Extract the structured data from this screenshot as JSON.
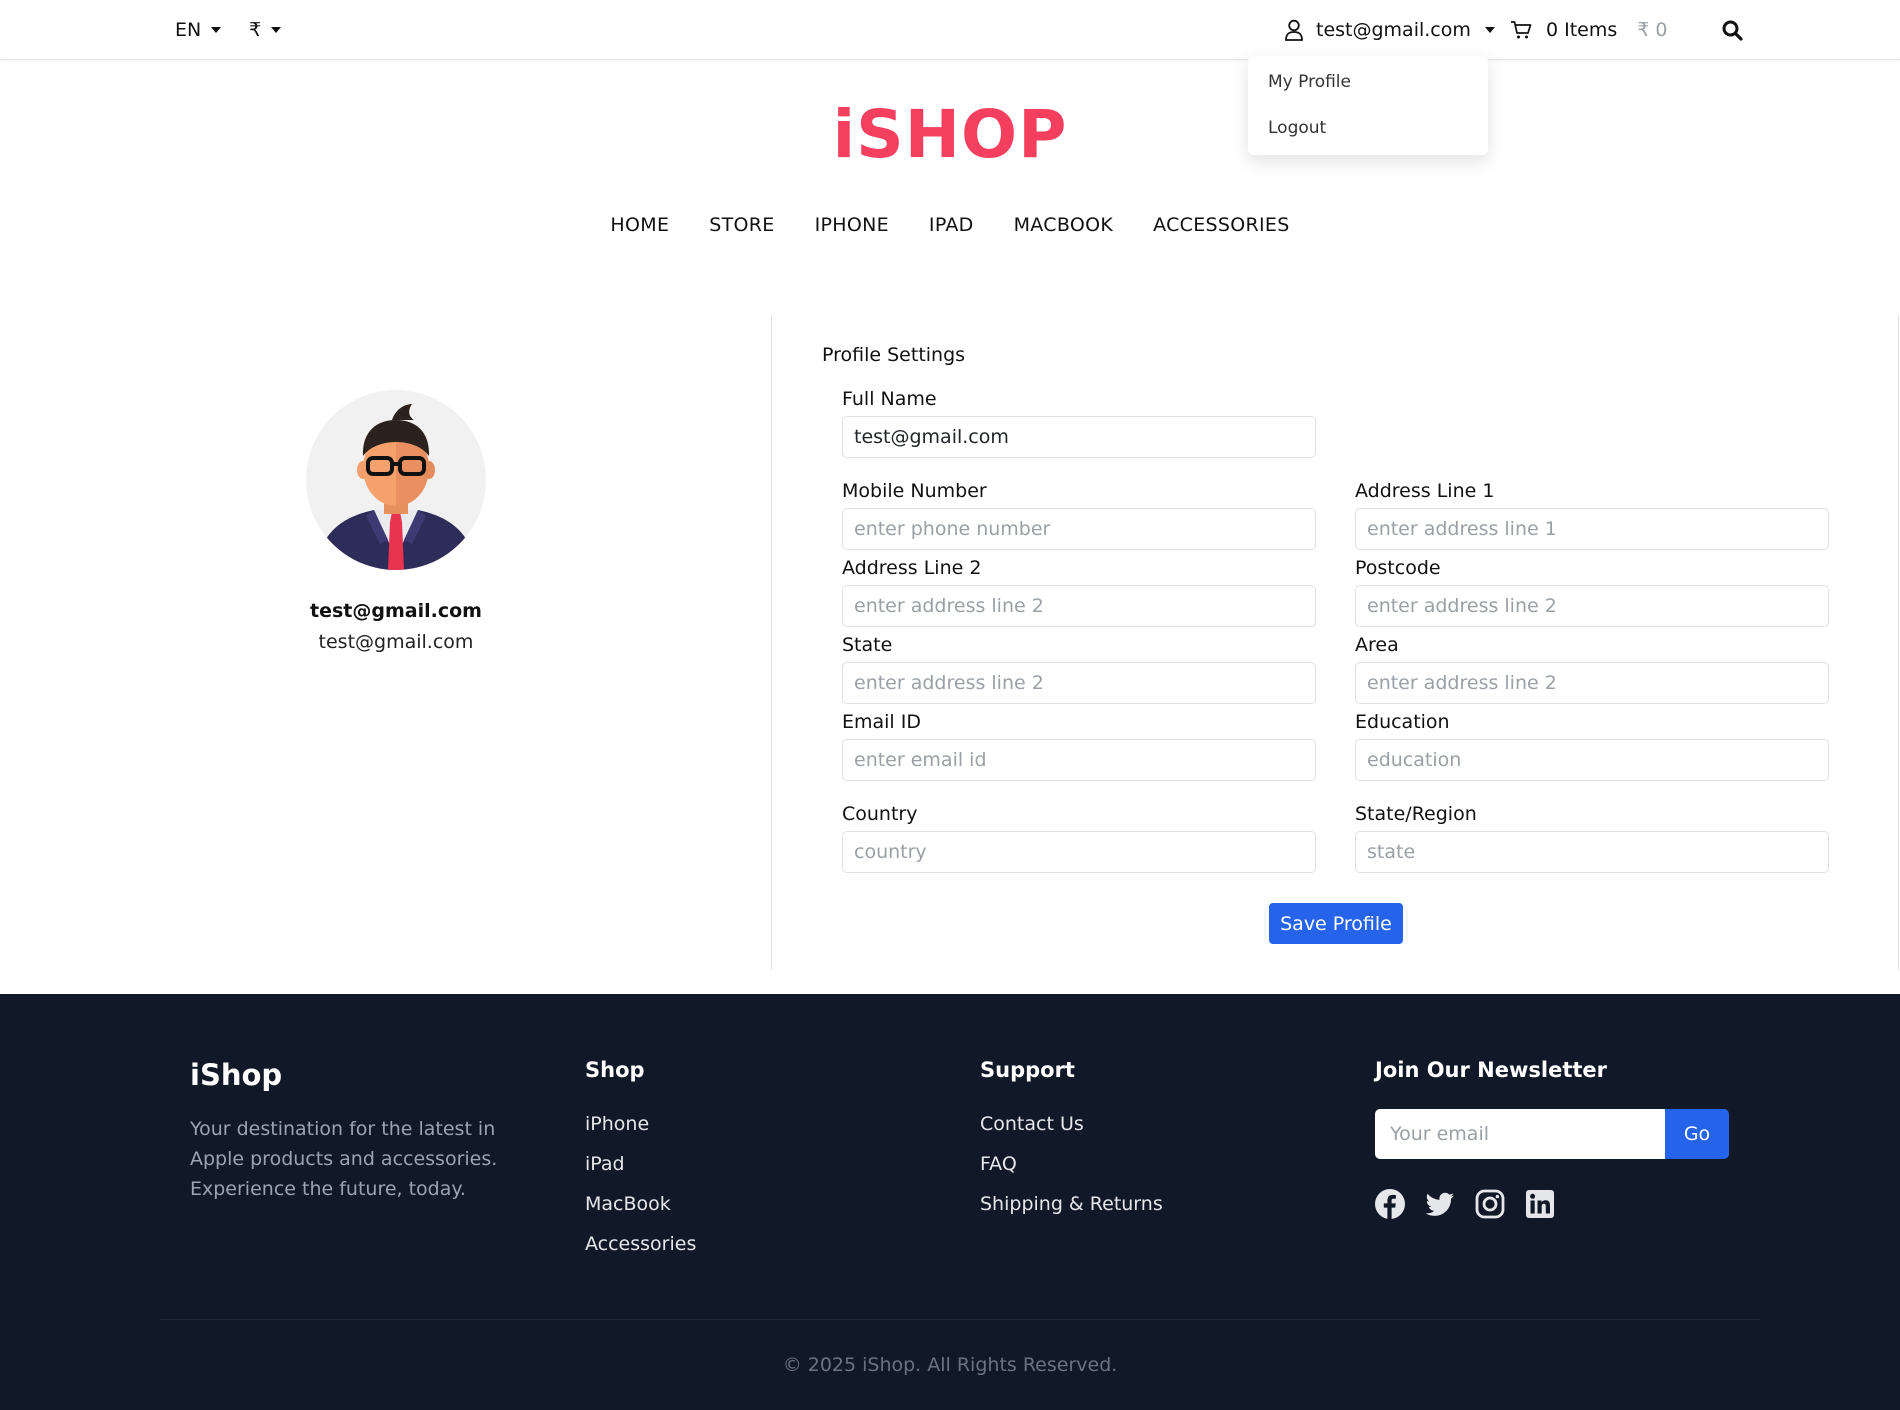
{
  "topbar": {
    "language": "EN",
    "currency": "₹",
    "user_email": "test@gmail.com",
    "cart_items": "0 Items",
    "cart_amount": "₹ 0",
    "icons": [
      "user-icon",
      "cart-icon",
      "search-icon"
    ]
  },
  "user_menu": {
    "items": [
      "My Profile",
      "Logout"
    ]
  },
  "logo": "iSHOP",
  "nav": [
    "HOME",
    "STORE",
    "IPHONE",
    "IPAD",
    "MACBOOK",
    "ACCESSORIES"
  ],
  "profile": {
    "name": "test@gmail.com",
    "email": "test@gmail.com"
  },
  "settings": {
    "title": "Profile Settings",
    "full_name": {
      "label": "Full Name",
      "value": "test@gmail.com"
    },
    "mobile": {
      "label": "Mobile Number",
      "placeholder": "enter phone number"
    },
    "address1": {
      "label": "Address Line 1",
      "placeholder": "enter address line 1"
    },
    "address2": {
      "label": "Address Line 2",
      "placeholder": "enter address line 2"
    },
    "postcode": {
      "label": "Postcode",
      "placeholder": "enter address line 2"
    },
    "state": {
      "label": "State",
      "placeholder": "enter address line 2"
    },
    "area": {
      "label": "Area",
      "placeholder": "enter address line 2"
    },
    "email_id": {
      "label": "Email ID",
      "placeholder": "enter email id"
    },
    "education": {
      "label": "Education",
      "placeholder": "education"
    },
    "country": {
      "label": "Country",
      "placeholder": "country"
    },
    "state_region": {
      "label": "State/Region",
      "placeholder": "state"
    },
    "save_label": "Save Profile"
  },
  "footer": {
    "brand": "iShop",
    "description": "Your destination for the latest in Apple products and accessories. Experience the future, today.",
    "shop": {
      "heading": "Shop",
      "links": [
        "iPhone",
        "iPad",
        "MacBook",
        "Accessories"
      ]
    },
    "support": {
      "heading": "Support",
      "links": [
        "Contact Us",
        "FAQ",
        "Shipping & Returns"
      ]
    },
    "newsletter": {
      "heading": "Join Our Newsletter",
      "placeholder": "Your email",
      "button": "Go"
    },
    "social_icons": [
      "facebook-icon",
      "twitter-icon",
      "instagram-icon",
      "linkedin-icon"
    ],
    "copyright": "© 2025 iShop. All Rights Reserved."
  },
  "colors": {
    "brand": "#f43f5e",
    "primary_button": "#2563eb",
    "footer_bg": "#111827"
  }
}
